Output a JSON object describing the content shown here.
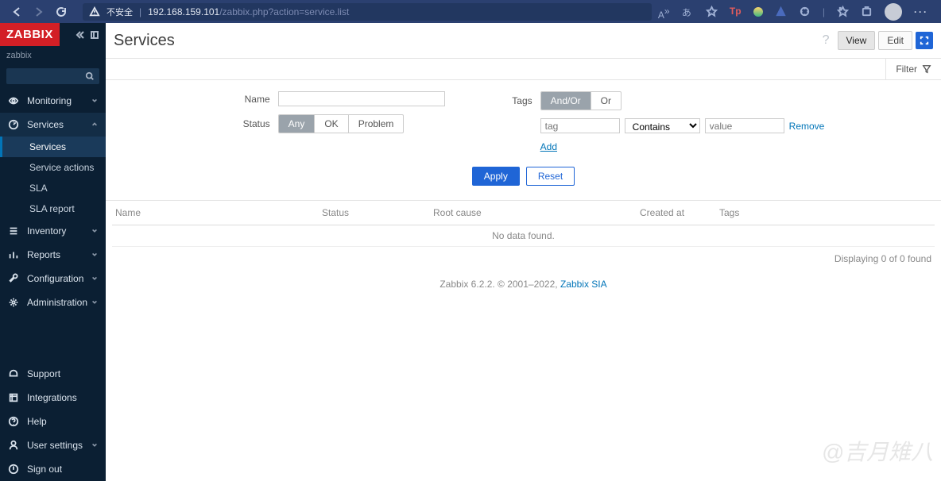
{
  "browser": {
    "insecure_label": "不安全",
    "url_host": "192.168.159.101",
    "url_path": "/zabbix.php?action=service.list"
  },
  "sidebar": {
    "logo": "ZABBIX",
    "tenant": "zabbix",
    "menu": {
      "monitoring": "Monitoring",
      "services": "Services",
      "inventory": "Inventory",
      "reports": "Reports",
      "configuration": "Configuration",
      "administration": "Administration"
    },
    "services_sub": [
      "Services",
      "Service actions",
      "SLA",
      "SLA report"
    ],
    "help": [
      "Support",
      "Integrations",
      "Help",
      "User settings",
      "Sign out"
    ]
  },
  "page": {
    "title": "Services",
    "view": "View",
    "edit": "Edit",
    "filter_label": "Filter"
  },
  "filter": {
    "name_label": "Name",
    "status_label": "Status",
    "status_opts": [
      "Any",
      "OK",
      "Problem"
    ],
    "tags_label": "Tags",
    "tags_opts": [
      "And/Or",
      "Or"
    ],
    "tag_placeholder": "tag",
    "operator_selected": "Contains",
    "value_placeholder": "value",
    "remove": "Remove",
    "add": "Add",
    "apply": "Apply",
    "reset": "Reset"
  },
  "table": {
    "cols": [
      "Name",
      "Status",
      "Root cause",
      "Created at",
      "Tags"
    ],
    "no_data": "No data found.",
    "pager": "Displaying 0 of 0 found"
  },
  "footer": {
    "version": "Zabbix 6.2.2. © 2001–2022, ",
    "link": "Zabbix SIA"
  },
  "watermark": "@吉月雉八"
}
